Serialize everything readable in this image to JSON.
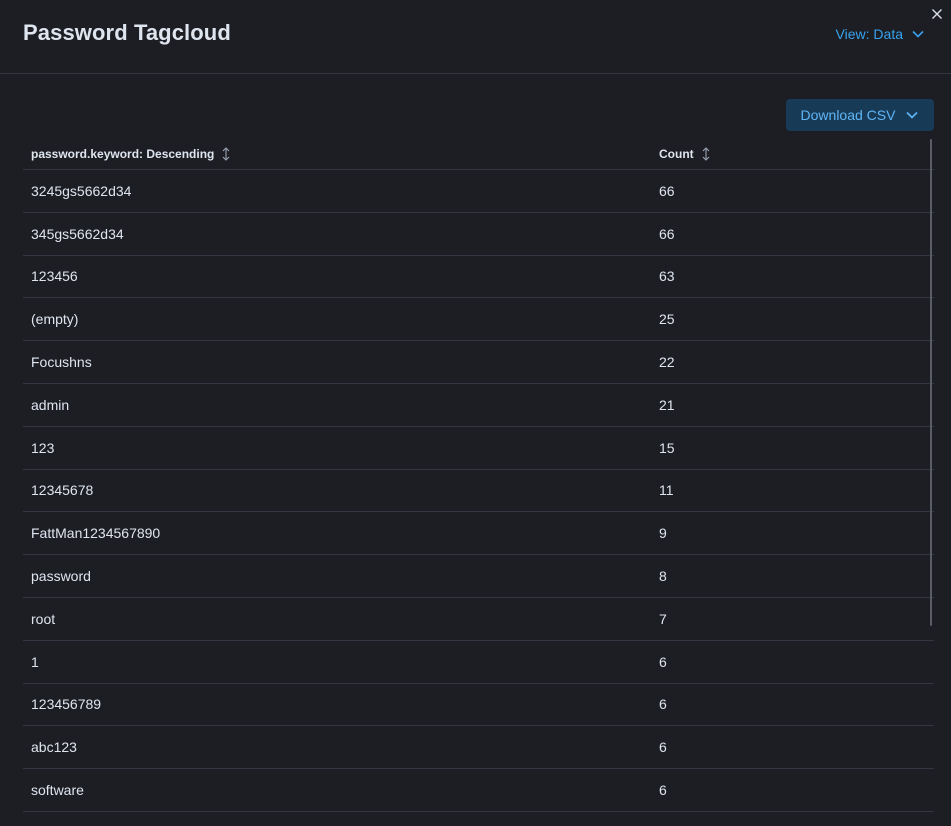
{
  "flyout": {
    "title": "Password Tagcloud",
    "view_label": "View: Data"
  },
  "toolbar": {
    "download_label": "Download CSV"
  },
  "table": {
    "columns": [
      {
        "label": "password.keyword: Descending"
      },
      {
        "label": "Count"
      }
    ],
    "rows": [
      {
        "keyword": "3245gs5662d34",
        "count": "66"
      },
      {
        "keyword": "345gs5662d34",
        "count": "66"
      },
      {
        "keyword": "123456",
        "count": "63"
      },
      {
        "keyword": "(empty)",
        "count": "25"
      },
      {
        "keyword": "Focushns",
        "count": "22"
      },
      {
        "keyword": "admin",
        "count": "21"
      },
      {
        "keyword": "123",
        "count": "15"
      },
      {
        "keyword": "12345678",
        "count": "11"
      },
      {
        "keyword": "FattMan1234567890",
        "count": "9"
      },
      {
        "keyword": "password",
        "count": "8"
      },
      {
        "keyword": "root",
        "count": "7"
      },
      {
        "keyword": "1",
        "count": "6"
      },
      {
        "keyword": "123456789",
        "count": "6"
      },
      {
        "keyword": "abc123",
        "count": "6"
      },
      {
        "keyword": "software",
        "count": "6"
      }
    ]
  },
  "colors": {
    "background": "#1d1e24",
    "text": "#dfe5ef",
    "link": "#36a2ef",
    "button_bg": "#173a56",
    "border": "#343741"
  }
}
